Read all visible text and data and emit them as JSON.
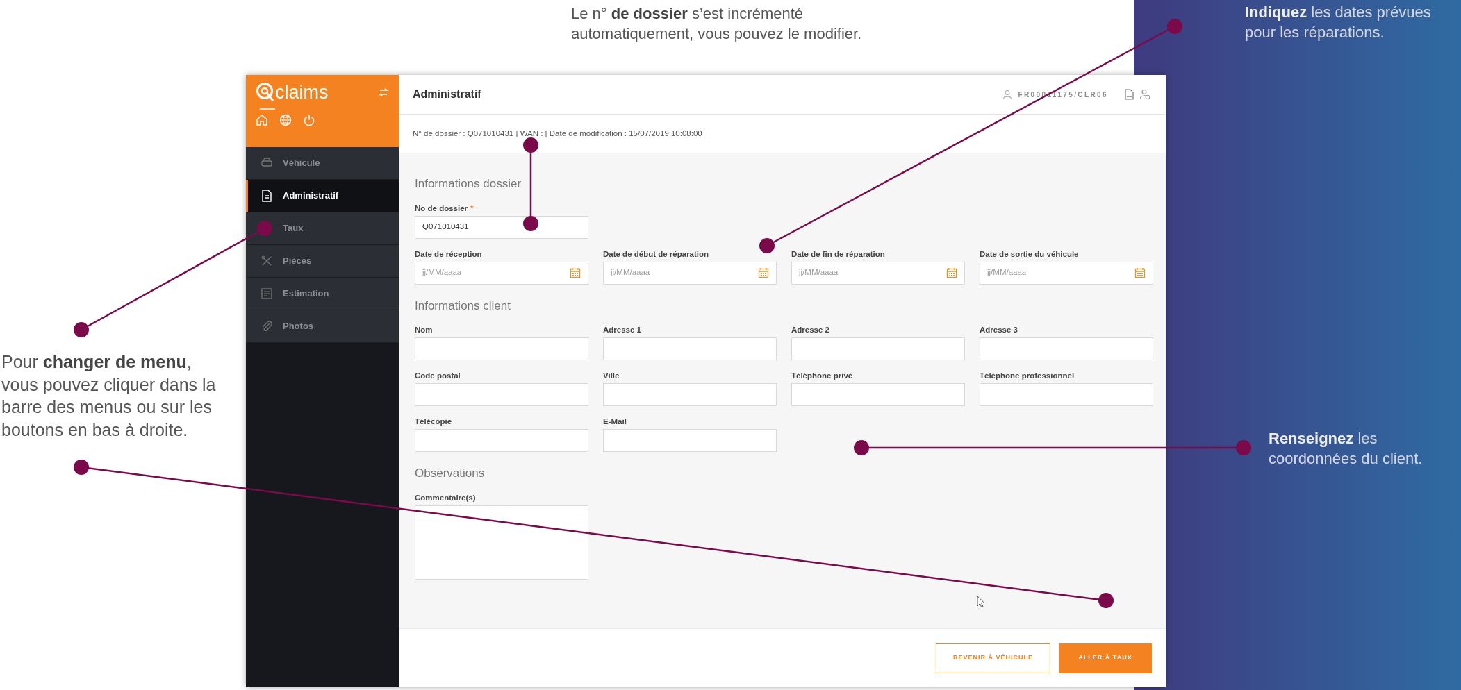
{
  "annotations": [
    {
      "text": "Le n° **de dossier** s’est incrémenté automatiquement, vous pouvez le modifier."
    },
    {
      "text": "Pour **changer de menu**, vous pouvez cliquer dans la barre des menus ou sur les boutons en bas à droite."
    },
    {
      "text": "**Indiquez** les dates prévues pour les réparations."
    },
    {
      "text": "**Renseignez** les coordonnées du client."
    }
  ],
  "app": {
    "logo": "claims",
    "sidebar": {
      "items": [
        {
          "label": "Véhicule",
          "selected": false
        },
        {
          "label": "Administratif",
          "selected": true
        },
        {
          "label": "Taux",
          "selected": false
        },
        {
          "label": "Pièces",
          "selected": false
        },
        {
          "label": "Estimation",
          "selected": false
        },
        {
          "label": "Photos",
          "selected": false
        }
      ]
    },
    "header": {
      "title": "Administratif",
      "user": "FR00011175/CLR06"
    },
    "info_line": "N° de dossier : Q071010431 | WAN : | Date de modification : 15/07/2019 10:08:00",
    "sections": [
      {
        "title": "Informations dossier",
        "rows": [
          [
            {
              "label": "No de dossier",
              "required_mark": "*",
              "kind": "text",
              "value": "Q071010431"
            }
          ],
          [
            {
              "label": "Date de réception",
              "kind": "date",
              "placeholder": "jj/MM/aaaa"
            },
            {
              "label": "Date de début de réparation",
              "kind": "date",
              "placeholder": "jj/MM/aaaa"
            },
            {
              "label": "Date de fin de réparation",
              "kind": "date",
              "placeholder": "jj/MM/aaaa"
            },
            {
              "label": "Date de sortie du véhicule",
              "kind": "date",
              "placeholder": "jj/MM/aaaa"
            }
          ]
        ]
      },
      {
        "title": "Informations client",
        "rows": [
          [
            {
              "label": "Nom",
              "kind": "text"
            },
            {
              "label": "Adresse 1",
              "kind": "text"
            },
            {
              "label": "Adresse 2",
              "kind": "text"
            },
            {
              "label": "Adresse 3",
              "kind": "text"
            }
          ],
          [
            {
              "label": "Code postal",
              "kind": "text"
            },
            {
              "label": "Ville",
              "kind": "text"
            },
            {
              "label": "Téléphone privé",
              "kind": "text"
            },
            {
              "label": "Téléphone professionnel",
              "kind": "text"
            }
          ],
          [
            {
              "label": "Télécopie",
              "kind": "text"
            },
            {
              "label": "E-Mail",
              "kind": "text"
            }
          ]
        ]
      },
      {
        "title": "Observations",
        "rows": [
          [
            {
              "label": "Commentaire(s)",
              "kind": "textarea"
            }
          ]
        ]
      }
    ],
    "buttons": [
      {
        "label": "REVENIR À VÉHICULE",
        "kind": "secondary"
      },
      {
        "label": "ALLER À TAUX",
        "kind": "primary"
      }
    ]
  }
}
